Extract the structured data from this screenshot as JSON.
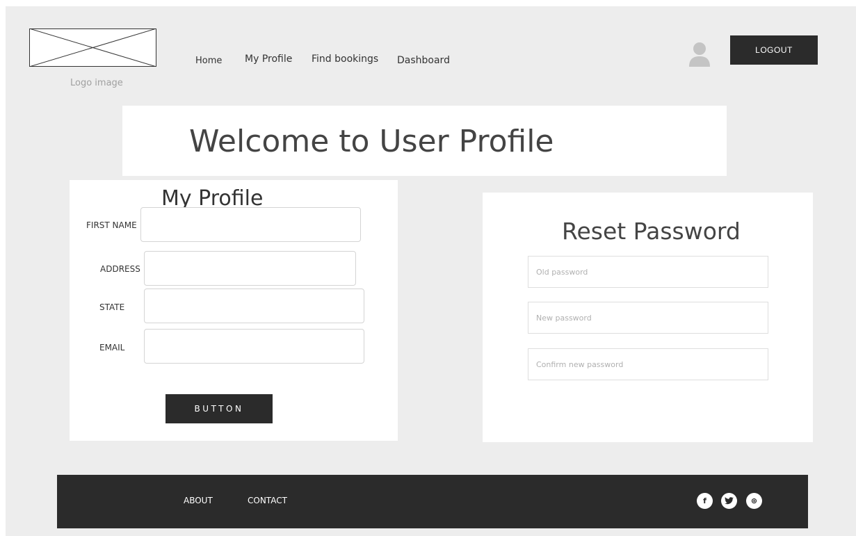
{
  "header": {
    "logo_caption": "Logo image",
    "nav": {
      "home": "Home",
      "my_profile": "My Profile",
      "find_bookings": "Find bookings",
      "dashboard": "Dashboard"
    },
    "logout_label": "LOGOUT"
  },
  "welcome": {
    "title": "Welcome to User Profile"
  },
  "profile_form": {
    "title": "My Profile",
    "labels": {
      "first_name": "FIRST NAME",
      "address": "ADDRESS",
      "state": "STATE",
      "email": "EMAIL"
    },
    "values": {
      "first_name": "",
      "address": "",
      "state": "",
      "email": ""
    },
    "button_label": "BUTTON"
  },
  "reset_password": {
    "title": "Reset Password",
    "placeholders": {
      "old": "Old password",
      "new": "New password",
      "confirm": "Confirm new password"
    }
  },
  "footer": {
    "about": "ABOUT",
    "contact": "CONTACT",
    "social": [
      {
        "name": "facebook-icon",
        "glyph": "f"
      },
      {
        "name": "twitter-icon",
        "glyph": "t"
      },
      {
        "name": "dribbble-icon",
        "glyph": "⊛"
      }
    ]
  },
  "colors": {
    "canvas": "#ededed",
    "dark": "#2b2b2b",
    "card": "#ffffff"
  }
}
